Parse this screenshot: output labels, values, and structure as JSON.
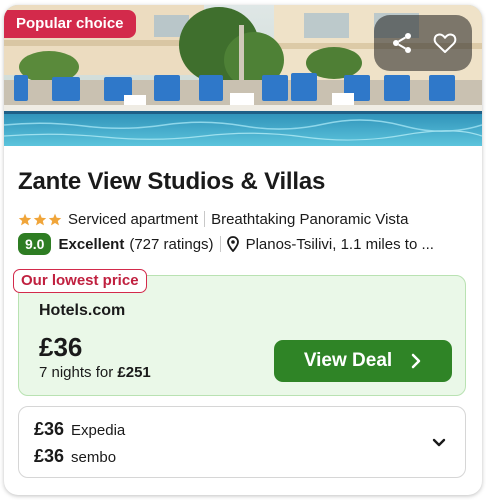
{
  "badge": "Popular choice",
  "hotel": {
    "name": "Zante View Studios & Villas",
    "stars": 3,
    "type": "Serviced apartment",
    "tagline": "Breathtaking Panoramic Vista",
    "score": "9.0",
    "rating_word": "Excellent",
    "ratings_count": "(727 ratings)",
    "location": "Planos-Tsilivi, 1.1 miles to ..."
  },
  "deal": {
    "label": "Our lowest price",
    "provider": "Hotels.com",
    "price": "£36",
    "nights_text": "7 nights for ",
    "total": "£251",
    "button": "View Deal"
  },
  "other_offers": [
    {
      "price": "£36",
      "provider": "Expedia"
    },
    {
      "price": "£36",
      "provider": "sembo"
    }
  ],
  "icons": {
    "share": "share-icon",
    "favourite": "heart-icon",
    "location": "location-pin-icon",
    "expand": "chevron-down-icon",
    "deal_arrow": "chevron-right-icon"
  },
  "colors": {
    "badge": "#d32a4b",
    "score": "#2e7d23",
    "button": "#2f8426",
    "deal_bg": "#eaf8e8",
    "stars": "#f0a53a"
  }
}
